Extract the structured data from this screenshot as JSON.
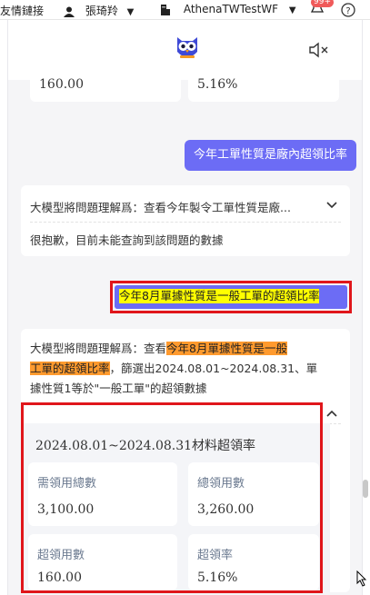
{
  "topbar": {
    "link_label": "友情鏈接",
    "user_name": "張琦羚",
    "company": "AthenaTWTestWF",
    "badge": "99+",
    "caret": "▼"
  },
  "top_stats": {
    "value_left": "160.00",
    "value_right": "5.16%"
  },
  "messages": {
    "user_q1": "今年工單性質是廠內超領比率",
    "ai_a1_interp": "大模型將問題理解爲：查看今年製令工單性質是廠...",
    "ai_a1_reply": "很抱歉，目前未能查詢到該問題的數據",
    "user_q2": "今年8月單據性質是一般工單的超領比率",
    "ai_a2_prefix": "大模型將問題理解爲：查看",
    "ai_a2_hl1": "今年8月單據性質是一般",
    "ai_a2_hl2": "工單的超領比率",
    "ai_a2_suffix1": "，篩選出2024.08.01~2024.08.31、單",
    "ai_a2_line3": "據性質1等於\"一般工單\"的超領數據"
  },
  "result_card": {
    "title": "2024.08.01~2024.08.31材料超領率",
    "metrics": [
      {
        "label": "需領用總數",
        "value": "3,100.00"
      },
      {
        "label": "總領用數",
        "value": "3,260.00"
      },
      {
        "label": "超領用數",
        "value": "160.00"
      },
      {
        "label": "超領率",
        "value": "5.16%"
      }
    ]
  },
  "colors": {
    "user_bubble": "#6c6cf5",
    "highlight": "#ff9a2e",
    "annotation_red": "#e0161b",
    "selection_yellow": "#ffff00"
  },
  "icons": [
    "user-icon",
    "building-icon",
    "bell-icon",
    "help-icon",
    "owl-logo-icon",
    "mute-icon",
    "chevron-down-icon",
    "chevron-up-icon",
    "cursor-icon"
  ]
}
